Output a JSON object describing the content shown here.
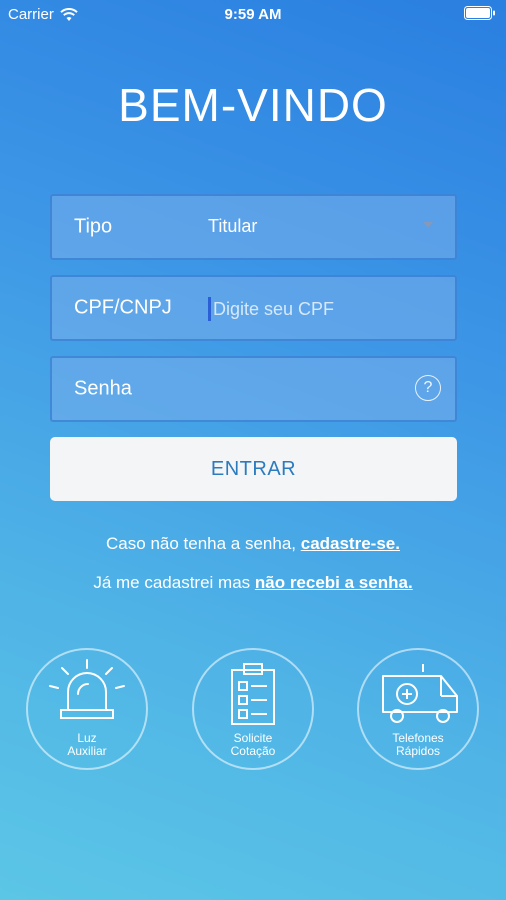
{
  "status": {
    "carrier": "Carrier",
    "time": "9:59 AM"
  },
  "title": "BEM-VINDO",
  "form": {
    "tipo_label": "Tipo",
    "tipo_value": "Titular",
    "cpf_label": "CPF/CNPJ",
    "cpf_placeholder": "Digite seu CPF",
    "senha_label": "Senha",
    "help_symbol": "?"
  },
  "enter_button": "ENTRAR",
  "register_line": {
    "prefix": "Caso não tenha a senha, ",
    "link": "cadastre-se."
  },
  "resend_line": {
    "prefix": "Já me cadastrei mas ",
    "link": "não recebi a senha."
  },
  "shortcuts": [
    {
      "line1": "Luz",
      "line2": "Auxiliar",
      "icon": "siren-icon"
    },
    {
      "line1": "Solicite",
      "line2": "Cotação",
      "icon": "clipboard-icon"
    },
    {
      "line1": "Telefones",
      "line2": "Rápidos",
      "icon": "ambulance-icon"
    }
  ],
  "colors": {
    "accent_text": "#2c7bbf",
    "background_top": "#2a7fe0",
    "background_bottom": "#5cc6e6"
  }
}
